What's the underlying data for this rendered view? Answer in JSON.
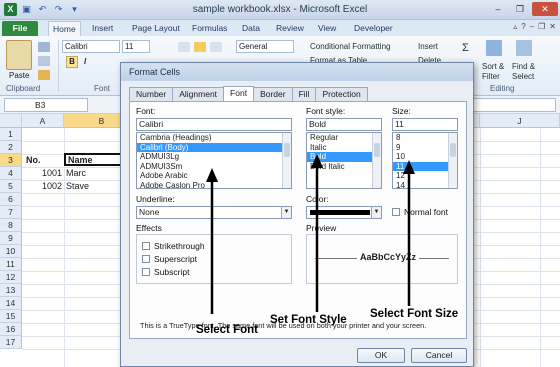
{
  "window": {
    "title": "sample workbook.xlsx - Microsoft Excel",
    "logo_letter": "X"
  },
  "ribbon": {
    "tabs": [
      "File",
      "Home",
      "Insert",
      "Page Layout",
      "Formulas",
      "Data",
      "Review",
      "View",
      "Developer"
    ],
    "active_tab": "Home",
    "paste_label": "Paste",
    "clipboard_label": "Clipboard",
    "font_group_label": "Font",
    "font_name": "Calibri",
    "font_size": "11",
    "bold_label": "B",
    "italic_label": "I",
    "number_format": "General",
    "conditional_formatting": "Conditional Formatting",
    "format_table_partial": "Format as Table",
    "insert_label": "Insert",
    "delete_label": "Delete",
    "sort_filter_label": "Sort &",
    "sort_filter_label2": "Filter",
    "find_select_label": "Find &",
    "find_select_label2": "Select",
    "editing_label": "Editing"
  },
  "formula_bar": {
    "name_box": "B3"
  },
  "sheet": {
    "columns": [
      "A",
      "B"
    ],
    "rows": [
      "1",
      "2",
      "3",
      "4",
      "5",
      "6",
      "7",
      "8",
      "9",
      "10",
      "11",
      "12",
      "13",
      "14",
      "15",
      "16",
      "17"
    ],
    "selected_row": "3",
    "selected_col": "B",
    "right_col": "J",
    "cells": {
      "a3": "No.",
      "b3": "Name",
      "a4": "1001",
      "b4": "Marc",
      "a5": "1002",
      "b5": "Stave"
    }
  },
  "dialog": {
    "title": "Format Cells",
    "tabs": [
      "Number",
      "Alignment",
      "Font",
      "Border",
      "Fill",
      "Protection"
    ],
    "active_tab": "Font",
    "font_label": "Font:",
    "font_value": "Calibri",
    "font_list": [
      "Cambria (Headings)",
      "Calibri (Body)",
      "ADMUI3Lg",
      "ADMUI3Sm",
      "Adobe Arabic",
      "Adobe Caslon Pro"
    ],
    "font_selected": "Calibri (Body)",
    "style_label": "Font style:",
    "style_value": "Bold",
    "style_list": [
      "Regular",
      "Italic",
      "Bold",
      "Bold Italic"
    ],
    "style_selected": "Bold",
    "size_label": "Size:",
    "size_value": "11",
    "size_list": [
      "8",
      "9",
      "10",
      "11",
      "12",
      "14"
    ],
    "size_selected": "11",
    "underline_label": "Underline:",
    "underline_value": "None",
    "color_label": "Color:",
    "normal_font_label": "Normal font",
    "effects_label": "Effects",
    "effects": [
      "Strikethrough",
      "Superscript",
      "Subscript"
    ],
    "preview_label": "Preview",
    "preview_text": "AaBbCcYyZz",
    "note": "This is a TrueType font.  The same font will be used on both your printer and your screen.",
    "ok_label": "OK",
    "cancel_label": "Cancel"
  },
  "annotations": {
    "select_font": "Select Font",
    "set_font_style": "Set Font Style",
    "select_font_size": "Select Font Size"
  }
}
